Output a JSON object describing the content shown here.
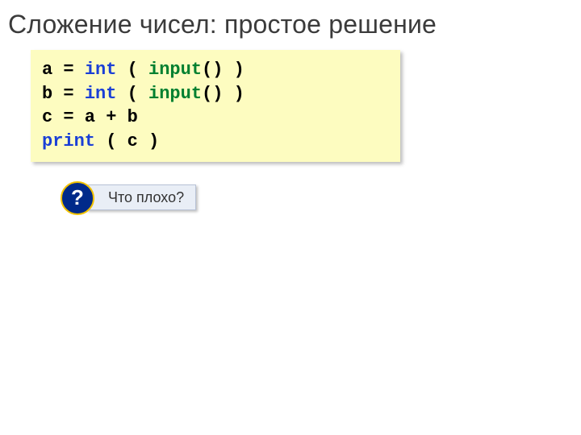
{
  "title": "Сложение чисел: простое решение",
  "code": {
    "l1": {
      "a": "a = ",
      "b": "int",
      "c": " ( ",
      "d": "input",
      "e": "() )"
    },
    "l2": {
      "a": "b = ",
      "b": "int",
      "c": " ( ",
      "d": "input",
      "e": "() )"
    },
    "l3": "c = a + b",
    "l4": {
      "a": "print",
      "b": " ( c )"
    }
  },
  "callout": {
    "mark": "?",
    "text": "Что плохо?"
  }
}
